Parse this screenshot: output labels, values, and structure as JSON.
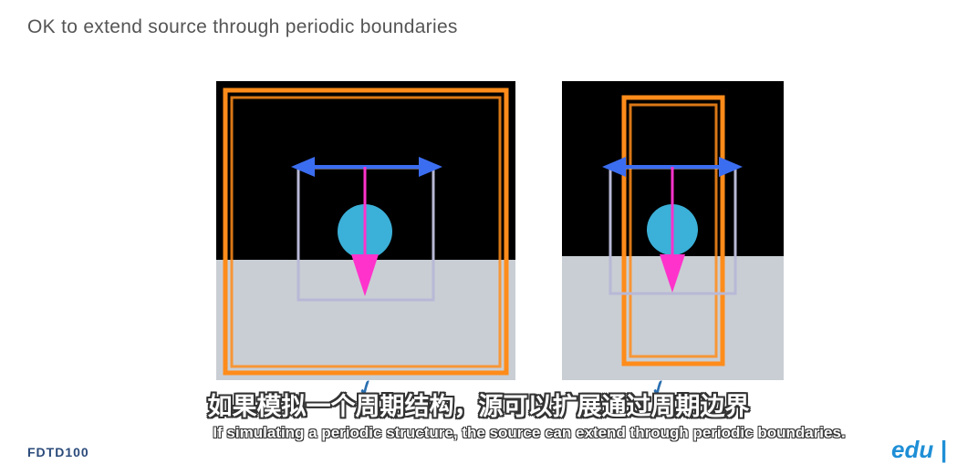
{
  "slide": {
    "title": "OK to extend source through periodic boundaries"
  },
  "subtitles": {
    "chinese": "如果模拟一个周期结构，源可以扩展通过周期边界",
    "english": "If simulating a periodic structure, the source can extend through periodic boundaries."
  },
  "footer": {
    "code": "FDTD100",
    "logo": "edu |"
  },
  "colors": {
    "background_top": "#000000",
    "background_bottom": "#c9ced4",
    "boundary": "#ff8c1a",
    "source_arrow": "#3b6df0",
    "injection_arrow": "#ff33cc",
    "particle": "#3bb0d8",
    "source_box": "#b8b8d6"
  },
  "panels": [
    {
      "label": "wide-simulation-region"
    },
    {
      "label": "narrow-simulation-region"
    }
  ]
}
